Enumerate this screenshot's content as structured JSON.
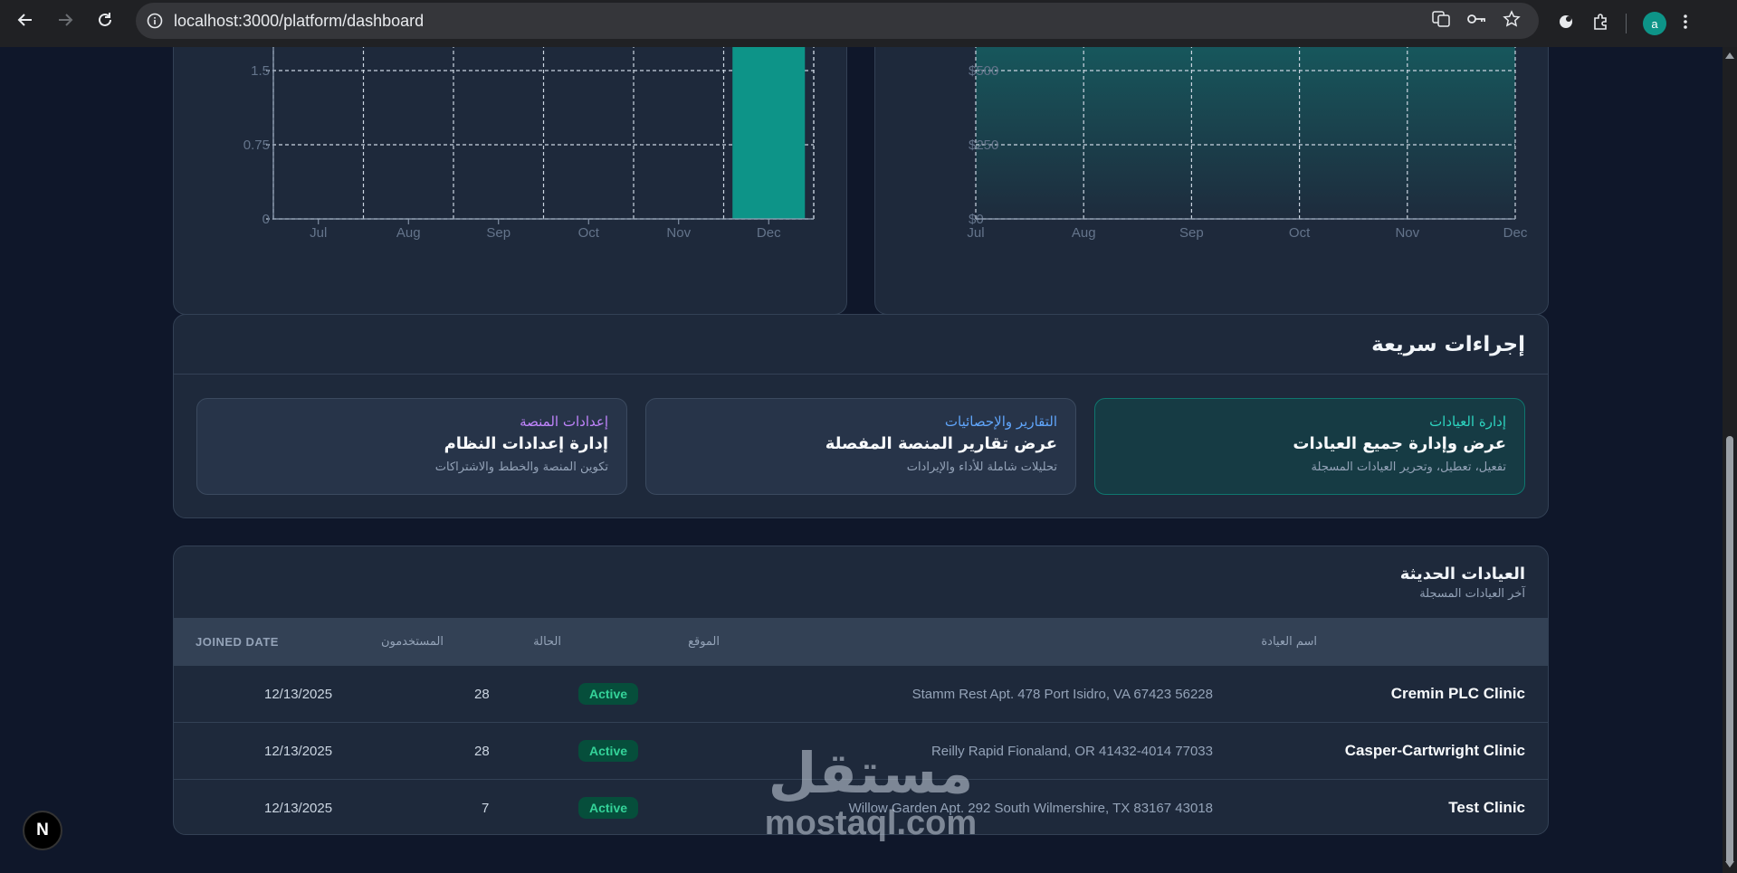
{
  "browser": {
    "url": "localhost:3000/platform/dashboard",
    "profile_initial": "a"
  },
  "charts": [
    {
      "chart_data": {
        "type": "bar",
        "categories": [
          "Jul",
          "Aug",
          "Sep",
          "Oct",
          "Nov",
          "Dec"
        ],
        "values": [
          0,
          0,
          0,
          0,
          0,
          2
        ],
        "y_ticks": [
          "0",
          "0.75",
          "1.5"
        ],
        "y_tick_values": [
          0,
          0.75,
          1.5
        ],
        "grid": true,
        "bar_color": "#0d9488"
      }
    },
    {
      "chart_data": {
        "type": "area",
        "x": [
          "Jul",
          "Aug",
          "Sep",
          "Oct",
          "Nov",
          "Dec"
        ],
        "values": [
          1000,
          1000,
          1000,
          1000,
          1000,
          1000
        ],
        "y_ticks": [
          "$0",
          "$250",
          "$500"
        ],
        "y_tick_values": [
          0,
          250,
          500
        ],
        "grid": true,
        "fill_color": "#0d9488"
      }
    }
  ],
  "quick_actions": {
    "title": "إجراءات سريعة",
    "items": [
      {
        "category": "إدارة العيادات",
        "title": "عرض وإدارة جميع العيادات",
        "desc": "تفعيل، تعطيل، وتحرير العيادات المسجلة",
        "color": "#2dd4bf"
      },
      {
        "category": "التقارير والإحصائيات",
        "title": "عرض تقارير المنصة المفصلة",
        "desc": "تحليلات شاملة للأداء والإيرادات",
        "color": "#60a5fa"
      },
      {
        "category": "إعدادات المنصة",
        "title": "إدارة إعدادات النظام",
        "desc": "تكوين المنصة والخطط والاشتراكات",
        "color": "#c084fc"
      }
    ]
  },
  "recent_clinics": {
    "title": "العيادات الحديثة",
    "subtitle": "آخر العيادات المسجلة",
    "columns": {
      "name": "اسم العيادة",
      "location": "الموقع",
      "status": "الحالة",
      "users": "المستخدمون",
      "joined": "JOINED DATE"
    },
    "rows": [
      {
        "name": "Cremin PLC Clinic",
        "location": "Stamm Rest Apt. 478 Port Isidro, VA 67423 56228",
        "status": "Active",
        "users": "28",
        "joined": "12/13/2025"
      },
      {
        "name": "Casper-Cartwright Clinic",
        "location": "Reilly Rapid Fionaland, OR 41432-4014 77033",
        "status": "Active",
        "users": "28",
        "joined": "12/13/2025"
      },
      {
        "name": "Test Clinic",
        "location": "Willow Garden Apt. 292 South Wilmershire, TX 83167 43018",
        "status": "Active",
        "users": "7",
        "joined": "12/13/2025"
      }
    ]
  },
  "floating": {
    "next_label": "N"
  },
  "watermark": {
    "arabic": "مستقل",
    "latin": "mostaql.com"
  }
}
